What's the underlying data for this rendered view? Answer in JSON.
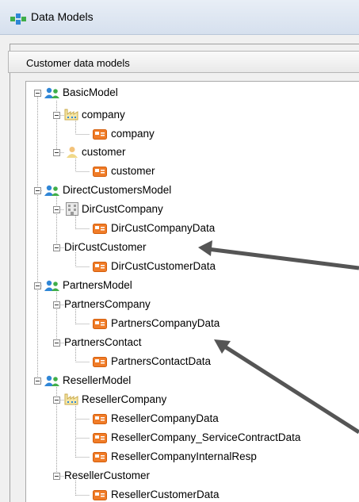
{
  "window": {
    "title": "Data Models"
  },
  "panel": {
    "header": "Customer data models"
  },
  "tree": {
    "basic": {
      "label": "BasicModel",
      "company": {
        "label": "company",
        "data": "company"
      },
      "customer": {
        "label": "customer",
        "data": "customer"
      }
    },
    "direct": {
      "label": "DirectCustomersModel",
      "company": {
        "label": "DirCustCompany",
        "data": "DirCustCompanyData"
      },
      "customer": {
        "label": "DirCustCustomer",
        "data": "DirCustCustomerData"
      }
    },
    "partners": {
      "label": "PartnersModel",
      "company": {
        "label": "PartnersCompany",
        "data": "PartnersCompanyData"
      },
      "contact": {
        "label": "PartnersContact",
        "data": "PartnersContactData"
      }
    },
    "reseller": {
      "label": "ResellerModel",
      "company": {
        "label": "ResellerCompany",
        "data1": "ResellerCompanyData",
        "data2": "ResellerCompany_ServiceContractData",
        "data3": "ResellerCompanyInternalResp"
      },
      "customer": {
        "label": "ResellerCustomer",
        "data": "ResellerCustomerData"
      }
    }
  },
  "icons": {
    "model": "users-icon",
    "data": "data-record-icon",
    "folder": "factory-icon",
    "building": "building-icon",
    "person": "person-icon"
  },
  "colors": {
    "accent_green": "#3fae49",
    "accent_blue": "#2f86d6",
    "data_orange": "#f07c28",
    "arrow": "#555555"
  }
}
